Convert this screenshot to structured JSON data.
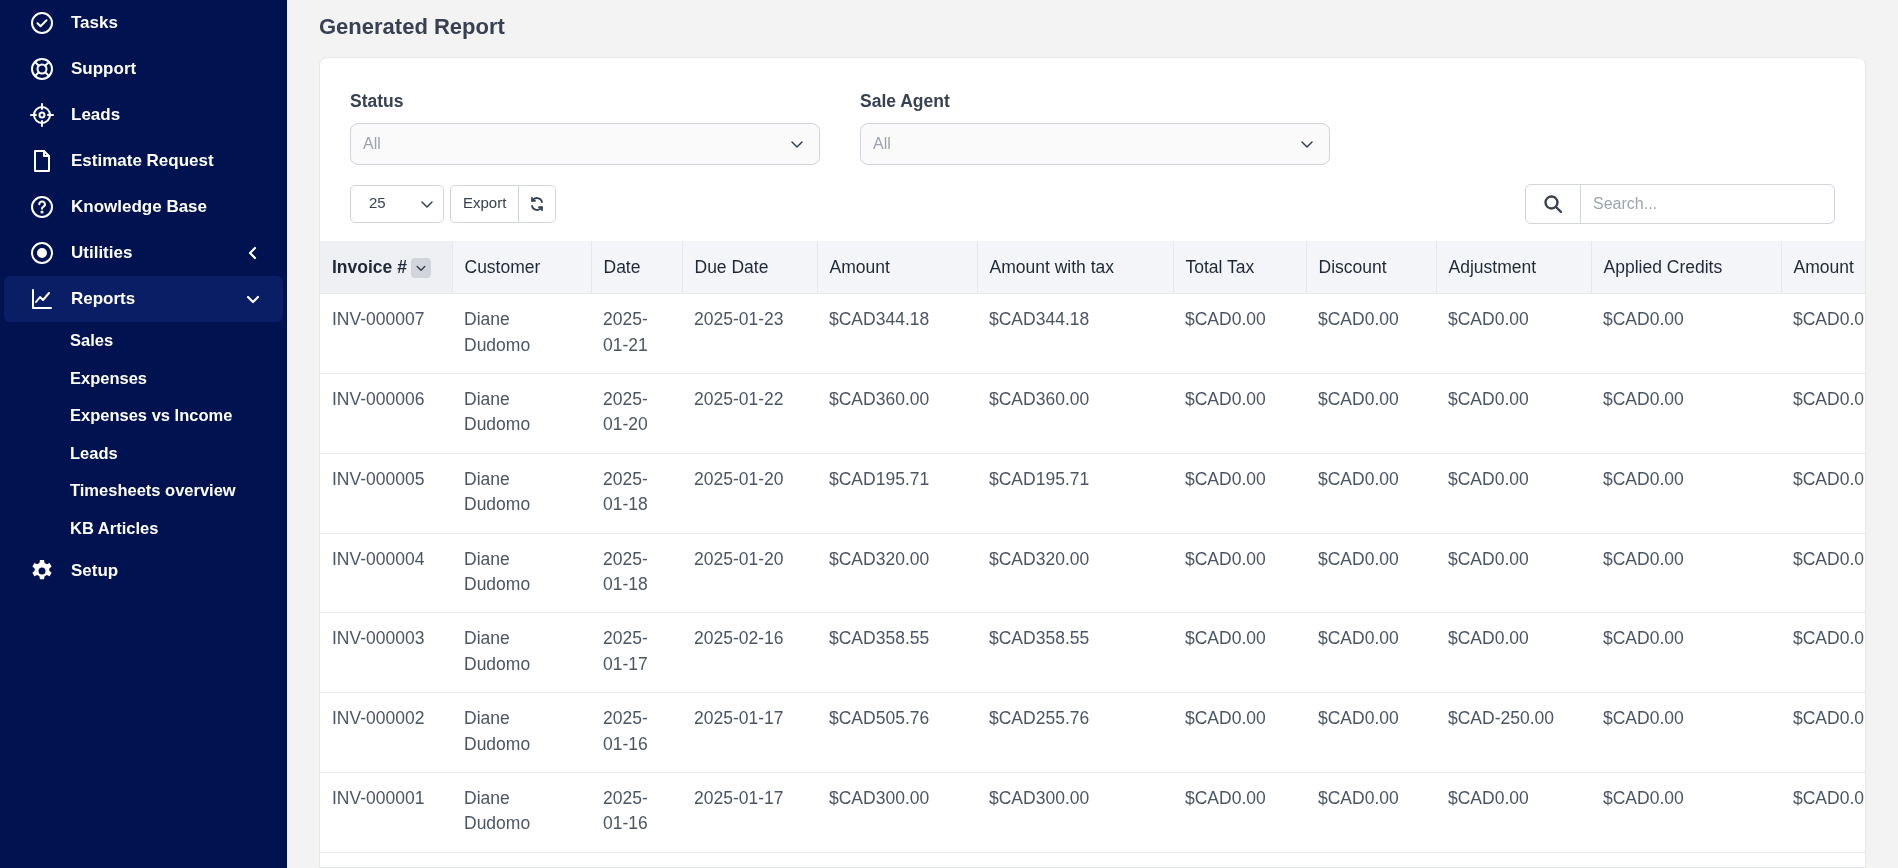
{
  "sidebar": {
    "items": [
      {
        "label": "Tasks",
        "selected": false
      },
      {
        "label": "Support",
        "selected": false
      },
      {
        "label": "Leads",
        "selected": false
      },
      {
        "label": "Estimate Request",
        "selected": false
      },
      {
        "label": "Knowledge Base",
        "selected": false
      },
      {
        "label": "Utilities",
        "selected": false,
        "expanded": false
      },
      {
        "label": "Reports",
        "selected": true,
        "expanded": true,
        "children": [
          {
            "label": "Sales"
          },
          {
            "label": "Expenses"
          },
          {
            "label": "Expenses vs Income"
          },
          {
            "label": "Leads"
          },
          {
            "label": "Timesheets overview"
          },
          {
            "label": "KB Articles"
          }
        ]
      },
      {
        "label": "Setup",
        "selected": false
      }
    ]
  },
  "page_title": "Generated Report",
  "filters": [
    {
      "label": "Status",
      "placeholder": "All"
    },
    {
      "label": "Sale Agent",
      "placeholder": "All"
    }
  ],
  "toolbar": {
    "page_length": "25",
    "export": "Export",
    "search": {
      "placeholder": "Search..."
    }
  },
  "table": {
    "columns": [
      {
        "label": "Invoice #",
        "sorted": true
      },
      {
        "label": "Customer",
        "sorted": false
      },
      {
        "label": "Date",
        "sorted": false
      },
      {
        "label": "Due Date",
        "sorted": false
      },
      {
        "label": "Amount",
        "sorted": false
      },
      {
        "label": "Amount with tax",
        "sorted": false
      },
      {
        "label": "Total Tax",
        "sorted": false
      },
      {
        "label": "Discount",
        "sorted": false
      },
      {
        "label": "Adjustment",
        "sorted": false
      },
      {
        "label": "Applied Credits",
        "sorted": false
      },
      {
        "label": "Amount",
        "sorted": false
      }
    ],
    "rows": [
      [
        "INV-000007",
        "Diane Dudomo",
        "2025-01-21",
        "2025-01-23",
        "$CAD344.18",
        "$CAD344.18",
        "$CAD0.00",
        "$CAD0.00",
        "$CAD0.00",
        "$CAD0.00",
        "$CAD0.0"
      ],
      [
        "INV-000006",
        "Diane Dudomo",
        "2025-01-20",
        "2025-01-22",
        "$CAD360.00",
        "$CAD360.00",
        "$CAD0.00",
        "$CAD0.00",
        "$CAD0.00",
        "$CAD0.00",
        "$CAD0.0"
      ],
      [
        "INV-000005",
        "Diane Dudomo",
        "2025-01-18",
        "2025-01-20",
        "$CAD195.71",
        "$CAD195.71",
        "$CAD0.00",
        "$CAD0.00",
        "$CAD0.00",
        "$CAD0.00",
        "$CAD0.0"
      ],
      [
        "INV-000004",
        "Diane Dudomo",
        "2025-01-18",
        "2025-01-20",
        "$CAD320.00",
        "$CAD320.00",
        "$CAD0.00",
        "$CAD0.00",
        "$CAD0.00",
        "$CAD0.00",
        "$CAD0.0"
      ],
      [
        "INV-000003",
        "Diane Dudomo",
        "2025-01-17",
        "2025-02-16",
        "$CAD358.55",
        "$CAD358.55",
        "$CAD0.00",
        "$CAD0.00",
        "$CAD0.00",
        "$CAD0.00",
        "$CAD0.0"
      ],
      [
        "INV-000002",
        "Diane Dudomo",
        "2025-01-16",
        "2025-01-17",
        "$CAD505.76",
        "$CAD255.76",
        "$CAD0.00",
        "$CAD0.00",
        "$CAD-250.00",
        "$CAD0.00",
        "$CAD0.0"
      ],
      [
        "INV-000001",
        "Diane Dudomo",
        "2025-01-16",
        "2025-01-17",
        "$CAD300.00",
        "$CAD300.00",
        "$CAD0.00",
        "$CAD0.00",
        "$CAD0.00",
        "$CAD0.00",
        "$CAD0.0"
      ]
    ]
  }
}
